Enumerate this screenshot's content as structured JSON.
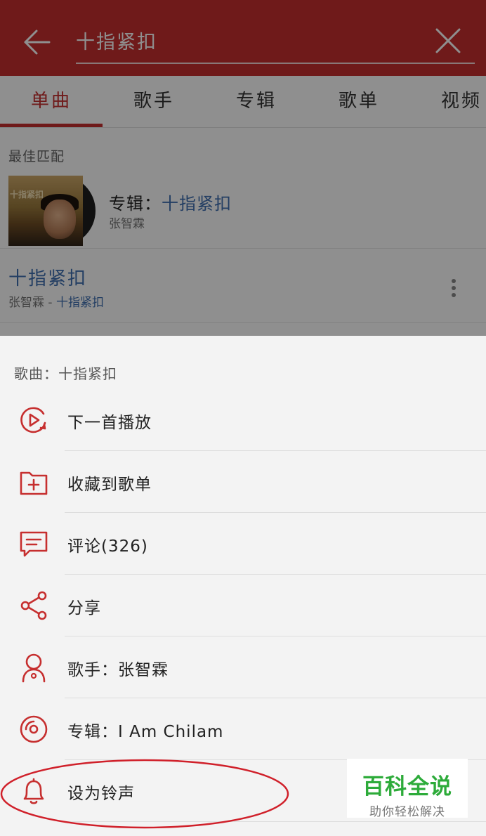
{
  "search": {
    "query": "十指紧扣"
  },
  "tabs": [
    {
      "label": "单曲",
      "active": true
    },
    {
      "label": "歌手",
      "active": false
    },
    {
      "label": "专辑",
      "active": false
    },
    {
      "label": "歌单",
      "active": false
    },
    {
      "label": "视频",
      "active": false
    }
  ],
  "best_match": {
    "title": "最佳匹配",
    "album_prefix": "专辑：",
    "album_name": "十指紧扣",
    "album_artist": "张智霖",
    "cover_text": "十指紧扣"
  },
  "song": {
    "title": "十指紧扣",
    "artist": "张智霖",
    "separator": " - ",
    "album": "十指紧扣"
  },
  "sheet": {
    "title": "歌曲：十指紧扣",
    "items": [
      {
        "label": "下一首播放",
        "icon": "play-next-icon"
      },
      {
        "label": "收藏到歌单",
        "icon": "folder-add-icon"
      },
      {
        "label": "评论(326)",
        "icon": "comment-icon"
      },
      {
        "label": "分享",
        "icon": "share-icon"
      },
      {
        "label": "歌手：张智霖",
        "icon": "artist-icon"
      },
      {
        "label": "专辑：I Am Chilam",
        "icon": "album-icon"
      },
      {
        "label": "设为铃声",
        "icon": "bell-icon"
      }
    ]
  },
  "watermark": {
    "main": "百科全说",
    "sub": "助你轻松解决"
  },
  "colors": {
    "brand": "#c62f2f",
    "link": "#3f6fb0",
    "annotation": "#d0202a",
    "watermark": "#2dab3a"
  }
}
